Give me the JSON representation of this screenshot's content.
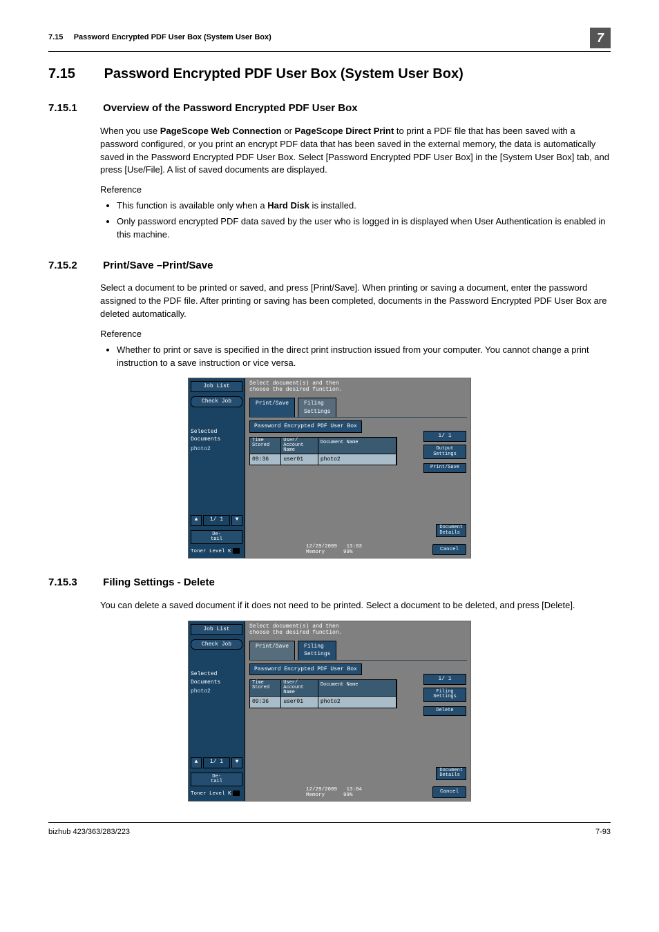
{
  "header": {
    "running_num": "7.15",
    "running_title": "Password Encrypted PDF User Box (System User Box)",
    "chapter_badge": "7"
  },
  "section": {
    "num": "7.15",
    "title": "Password Encrypted PDF User Box (System User Box)"
  },
  "sub1": {
    "num": "7.15.1",
    "title": "Overview of the Password Encrypted PDF User Box",
    "para_before": "When you use ",
    "bold1": "PageScope Web Connection",
    "para_mid": " or ",
    "bold2": "PageScope Direct Print",
    "para_after": " to print a PDF file that has been saved with a password configured, or you print an encrypt PDF data that has been saved in the external memory, the data is automatically saved in the Password Encrypted PDF User Box. Select [Password Encrypted PDF User Box] in the [System User Box] tab, and press [Use/File]. A list of saved documents are displayed.",
    "reference_label": "Reference",
    "bullet1_before": "This function is available only when a ",
    "bullet1_bold": "Hard Disk",
    "bullet1_after": " is installed.",
    "bullet2": "Only password encrypted PDF data saved by the user who is logged in is displayed when User Authentication is enabled in this machine."
  },
  "sub2": {
    "num": "7.15.2",
    "title": "Print/Save –Print/Save",
    "para": "Select a document to be printed or saved, and press [Print/Save]. When printing or saving a document, enter the password assigned to the PDF file. After printing or saving has been completed, documents in the Password Encrypted PDF User Box are deleted automatically.",
    "reference_label": "Reference",
    "bullet1": "Whether to print or save is specified in the direct print instruction issued from your computer. You cannot change a print instruction to a save instruction or vice versa."
  },
  "sub3": {
    "num": "7.15.3",
    "title": "Filing Settings - Delete",
    "para": "You can delete a saved document if it does not need to be printed. Select a document to be deleted, and press [Delete]."
  },
  "screenshot_common": {
    "job_list": "Job List",
    "check_job": "Check Job",
    "selected_docs_label": "Selected Documents",
    "selected_docs_value": "photo2",
    "page_indicator": "1/  1",
    "detail_btn": "De-\ntail",
    "toner_label": "Toner Level  K",
    "instruction_l1": "Select document(s) and then",
    "instruction_l2": "choose the desired function.",
    "tab_printsave": "Print/Save",
    "tab_filing_l1": "Filing",
    "tab_filing_l2": "Settings",
    "subtab": "Password Encrypted PDF User Box",
    "col_time_l1": "Time",
    "col_time_l2": "Stored",
    "col_user_l1": "User/",
    "col_user_l2": "Account Name",
    "col_docname": "Document Name",
    "row_time": "09:36",
    "row_user": "user01",
    "row_doc": "photo2",
    "main_page": "1/    1",
    "doc_details_l1": "Document",
    "doc_details_l2": "Details",
    "cancel": "Cancel",
    "date": "12/29/2009",
    "memory_label": "Memory",
    "memory_val": "99%"
  },
  "screenshot1": {
    "time": "13:03",
    "right_btn1_l1": "Output",
    "right_btn1_l2": "Settings",
    "right_btn2": "Print/Save"
  },
  "screenshot2": {
    "time": "13:04",
    "right_btn1_l1": "Filing",
    "right_btn1_l2": "Settings",
    "right_btn2": "Delete"
  },
  "footer": {
    "left": "bizhub 423/363/283/223",
    "right": "7-93"
  }
}
